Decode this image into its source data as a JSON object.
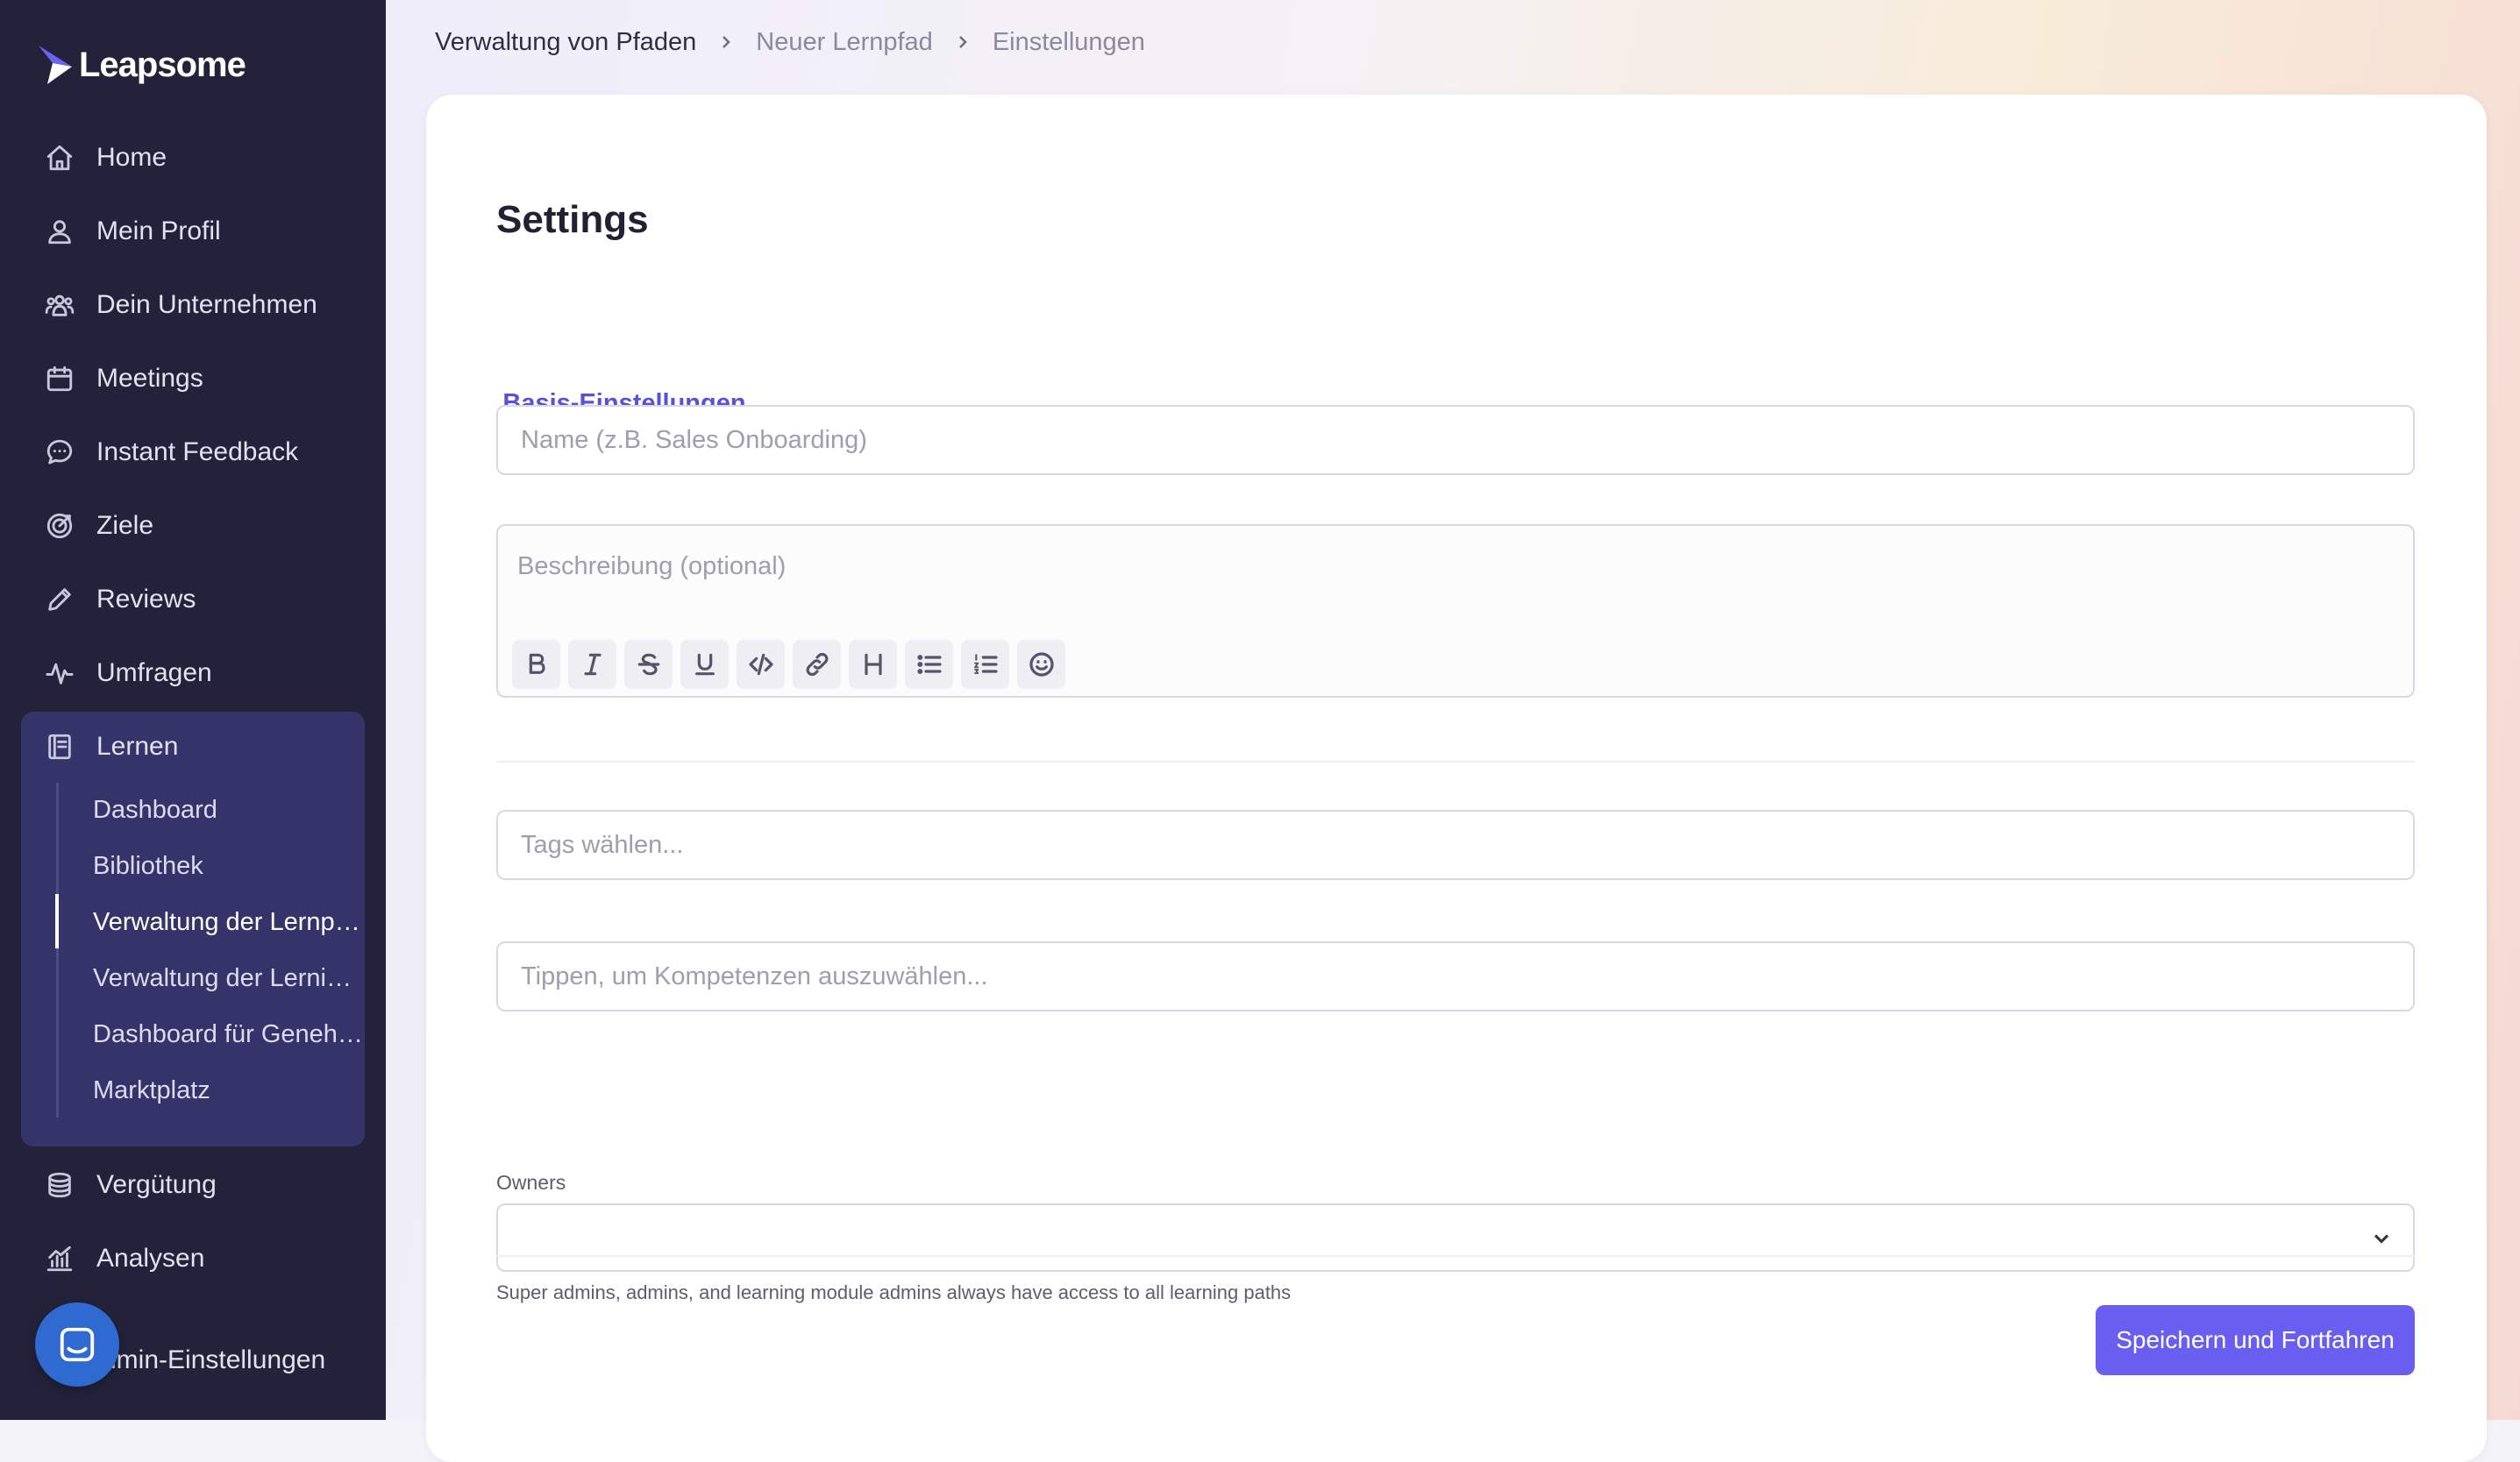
{
  "brand": {
    "name": "Leapsome"
  },
  "sidebar": {
    "items": [
      {
        "label": "Home",
        "icon": "home-icon"
      },
      {
        "label": "Mein Profil",
        "icon": "user-icon"
      },
      {
        "label": "Dein Unternehmen",
        "icon": "users-icon"
      },
      {
        "label": "Meetings",
        "icon": "calendar-icon"
      },
      {
        "label": "Instant Feedback",
        "icon": "chat-icon"
      },
      {
        "label": "Ziele",
        "icon": "target-icon"
      },
      {
        "label": "Reviews",
        "icon": "pencil-icon"
      },
      {
        "label": "Umfragen",
        "icon": "pulse-icon"
      },
      {
        "label": "Lernen",
        "icon": "book-icon"
      },
      {
        "label": "Vergütung",
        "icon": "coins-icon"
      },
      {
        "label": "Analysen",
        "icon": "analytics-icon"
      },
      {
        "label": "Admin-Einstellungen",
        "icon": "settings-icon"
      }
    ],
    "learn_sub": [
      {
        "label": "Dashboard"
      },
      {
        "label": "Bibliothek"
      },
      {
        "label": "Verwaltung der Lernpfade",
        "active": true
      },
      {
        "label": "Verwaltung der Lerninhalte"
      },
      {
        "label": "Dashboard für Genehmigungen"
      },
      {
        "label": "Marktplatz"
      }
    ],
    "admin_visible_label": "dmin-Einstellungen"
  },
  "breadcrumb": [
    "Verwaltung von Pfaden",
    "Neuer Lernpfad",
    "Einstellungen"
  ],
  "page": {
    "title": "Settings",
    "tab": "Basis-Einstellungen",
    "name_placeholder": "Name (z.B. Sales Onboarding)",
    "description_placeholder": "Beschreibung (optional)",
    "editor_tools": [
      "bold",
      "italic",
      "strikethrough",
      "underline",
      "code",
      "link",
      "heading",
      "bullet-list",
      "numbered-list",
      "emoji"
    ],
    "tags_placeholder": "Tags wählen...",
    "skills_placeholder": "Tippen, um Kompetenzen auszuwählen...",
    "owners_label": "Owners",
    "owners_value": "",
    "owners_help": "Super admins, admins, and learning module admins always have access to all learning paths",
    "save_label": "Speichern und Fortfahren"
  },
  "colors": {
    "sidebar_bg": "#23223a",
    "sidebar_group_bg": "#34336a",
    "accent": "#6a5ef0",
    "tab_accent": "#5a52d4",
    "chat_bubble": "#2f6ad0"
  }
}
